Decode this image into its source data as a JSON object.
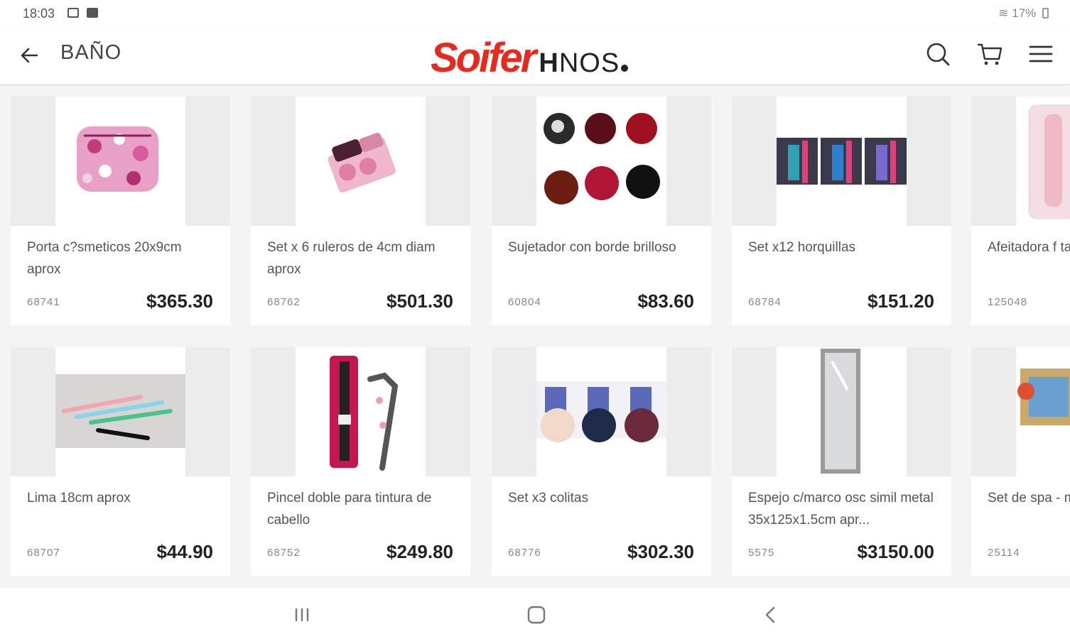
{
  "status": {
    "time": "18:03",
    "battery": "17%"
  },
  "header": {
    "title": "BAÑO",
    "logo_main": "Soifer",
    "logo_sub_bold": "H",
    "logo_sub": "NOS"
  },
  "products": [
    {
      "name": "Porta c?smeticos 20x9cm aprox",
      "code": "68741",
      "price": "$365.30"
    },
    {
      "name": "Set x 6 ruleros de 4cm diam aprox",
      "code": "68762",
      "price": "$501.30"
    },
    {
      "name": "Sujetador con borde brilloso",
      "code": "60804",
      "price": "$83.60"
    },
    {
      "name": "Set x12 horquillas",
      "code": "68784",
      "price": "$151.20"
    },
    {
      "name": "Afeitadora f tapa deco -",
      "code": "125048",
      "price": ""
    },
    {
      "name": "Lima 18cm aprox",
      "code": "68707",
      "price": "$44.90"
    },
    {
      "name": "Pincel doble para tintura de cabello",
      "code": "68752",
      "price": "$249.80"
    },
    {
      "name": "Set x3 colitas",
      "code": "68776",
      "price": "$302.30"
    },
    {
      "name": "Espejo c/marco osc simil metal 35x125x1.5cm apr...",
      "code": "5575",
      "price": "$3150.00"
    },
    {
      "name": "Set de spa - medias anti",
      "code": "25114",
      "price": ""
    }
  ],
  "colors": {
    "brand_red": "#e42b1d",
    "text_dark": "#222222",
    "background": "#f4f4f4"
  },
  "icons": [
    "back-arrow-icon",
    "search-icon",
    "cart-icon",
    "menu-icon",
    "recents-icon",
    "home-icon",
    "nav-back-icon"
  ]
}
